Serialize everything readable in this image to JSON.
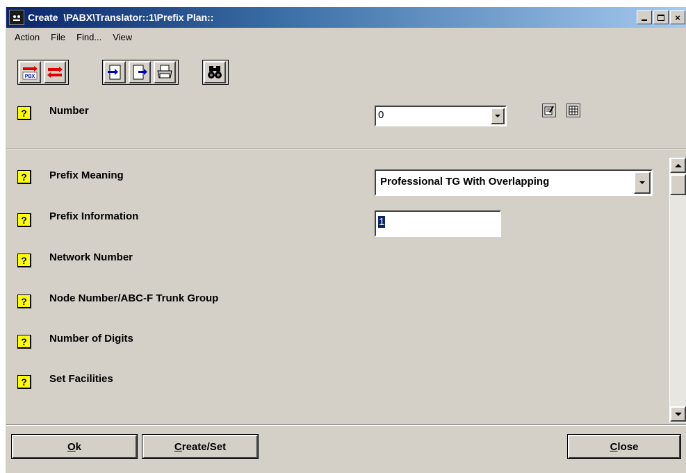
{
  "window": {
    "title": "Create  \\PABX\\Translator::1\\Prefix Plan::",
    "app_icon": "pabx-app-icon",
    "controls": {
      "close_glyph": "×"
    }
  },
  "menu": [
    "Action",
    "File",
    "Find...",
    "View"
  ],
  "toolbar": {
    "buttons": [
      {
        "icon": "pbx-connect-icon",
        "text": "PBX"
      },
      {
        "icon": "transfer-arrows-icon"
      },
      {
        "icon": "import-document-icon"
      },
      {
        "icon": "export-document-icon"
      },
      {
        "icon": "printer-icon"
      },
      {
        "icon": "binoculars-icon"
      }
    ]
  },
  "help_glyph": "?",
  "number": {
    "label": "Number",
    "value": "0",
    "side_icons": [
      "edit-note-icon",
      "grid-table-icon"
    ]
  },
  "fields": [
    {
      "label": "Prefix Meaning",
      "type": "select",
      "value": "Professional TG With Overlapping"
    },
    {
      "label": "Prefix Information",
      "type": "text",
      "value": "1"
    },
    {
      "label": "Network Number"
    },
    {
      "label": "Node Number/ABC-F Trunk Group"
    },
    {
      "label": "Number of Digits"
    },
    {
      "label": "Set Facilities"
    }
  ],
  "buttons": {
    "ok": "Ok",
    "create_set": "Create/Set",
    "close": "Close"
  }
}
